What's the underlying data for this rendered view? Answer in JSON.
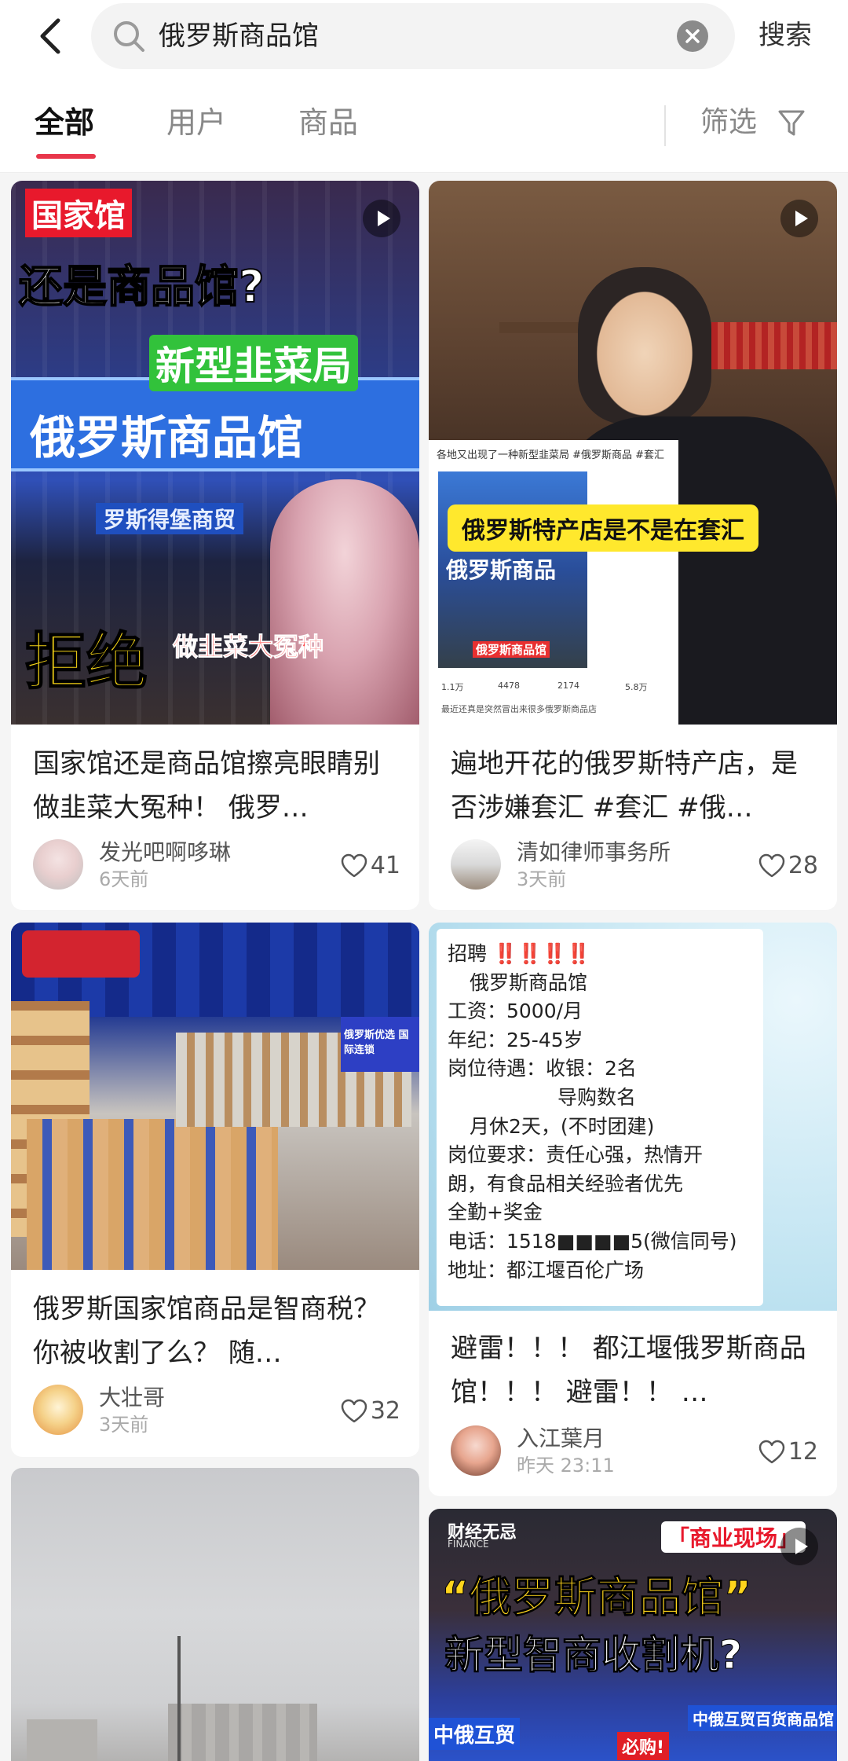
{
  "search": {
    "query": "俄罗斯商品馆",
    "submit_label": "搜索"
  },
  "tabs": [
    {
      "label": "全部"
    },
    {
      "label": "用户"
    },
    {
      "label": "商品"
    }
  ],
  "filter_label": "筛选",
  "colors": {
    "accent": "#e8364a",
    "background": "#f5f5f5",
    "card": "#ffffff"
  },
  "cards": [
    {
      "title": "国家馆还是商品馆擦亮眼睛别做韭菜大冤种！ 俄罗…",
      "author": "发光吧啊哆琳",
      "time": "6天前",
      "likes": "41",
      "overlay": {
        "tag": "国家馆",
        "headline": "还是商品馆?",
        "banner": "新型韭菜局",
        "store": "俄罗斯商品馆",
        "sub": "罗斯得堡商贸",
        "refuse": "拒绝",
        "refuse_sub": "做韭菜大冤种"
      }
    },
    {
      "title": "遍地开花的俄罗斯特产店，是否涉嫌套汇 #套汇 #俄…",
      "author": "清如律师事务所",
      "time": "3天前",
      "likes": "28",
      "overlay": {
        "caption": "俄罗斯特产店是不是在套汇",
        "note": "各地又出现了一种新型韭菜局 #俄罗斯商品 #套汇",
        "store_sign": "俄罗斯商品",
        "inner_tag": "俄罗斯商品馆",
        "stats": [
          "1.1万",
          "4478",
          "2174",
          "5.8万"
        ],
        "comment": "最近还真是突然冒出来很多俄罗斯商品店"
      }
    },
    {
      "title": "俄罗斯国家馆商品是智商税？你被收割了么？ 随…",
      "author": "大壮哥",
      "time": "3天前",
      "likes": "32",
      "overlay": {
        "sign": "俄罗斯优选 国际连锁"
      }
    },
    {
      "title": "避雷！！！ 都江堰俄罗斯商品馆！！！ 避雷！！ …",
      "author": "入江葉月",
      "time": "昨天 23:11",
      "likes": "12",
      "overlay": {
        "lines": [
          "招聘 ‼️‼️‼️‼️",
          "俄罗斯商品馆",
          "工资：5000/月",
          "年纪：25-45岁",
          "岗位待遇：收银：2名",
          "导购数名",
          "月休2天，(不时团建)",
          "岗位要求：责任心强，热情开",
          "朗，有食品相关经验者优先",
          "全勤+奖金",
          "电话：1518■■■■5(微信同号)",
          "地址：都江堰百伦广场"
        ]
      }
    },
    {
      "title": "",
      "author": "",
      "time": "",
      "likes": "",
      "overlay": {}
    },
    {
      "title": "",
      "author": "",
      "time": "",
      "likes": "",
      "overlay": {
        "brand": "财经无忌",
        "brand_en": "FINANCE",
        "tag": "「商业现场」",
        "headline1": "“俄罗斯商品馆”",
        "headline2": "新型智商收割机?",
        "store": "中俄互贸",
        "store2": "必购!",
        "store3": "中俄互贸百货商品馆"
      }
    }
  ]
}
